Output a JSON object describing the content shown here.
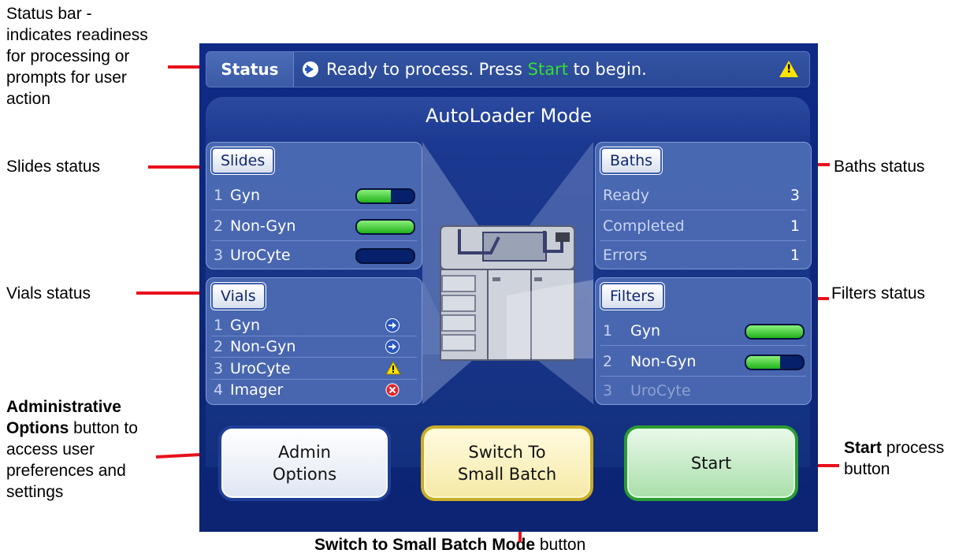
{
  "annotations": {
    "status_bar": [
      "Status bar -",
      "indicates readiness",
      "for processing or",
      "prompts for user",
      "action"
    ],
    "slides": "Slides status",
    "vials": "Vials status",
    "admin_bold": "Administrative",
    "admin_bold2": "Options",
    "admin_rest": [
      " button to",
      "access user",
      "preferences and",
      "settings"
    ],
    "baths": "Baths status",
    "filters": "Filters status",
    "start_bold": "Start",
    "start_rest": " process",
    "start_rest2": "button",
    "switch_bold": "Switch to Small Batch Mode",
    "switch_rest": " button"
  },
  "status": {
    "label": "Status",
    "message_prefix": "Ready to process.  Press ",
    "message_highlight": "Start",
    "message_suffix": " to begin.",
    "highlight_color": "#33dd33"
  },
  "mode_title": "AutoLoader Mode",
  "slides": {
    "button": "Slides",
    "rows": [
      {
        "num": "1",
        "label": "Gyn",
        "fill": 0.6
      },
      {
        "num": "2",
        "label": "Non-Gyn",
        "fill": 1.0
      },
      {
        "num": "3",
        "label": "UroCyte",
        "fill": 0.0
      }
    ]
  },
  "baths": {
    "button": "Baths",
    "rows": [
      {
        "label": "Ready",
        "value": "3"
      },
      {
        "label": "Completed",
        "value": "1"
      },
      {
        "label": "Errors",
        "value": "1"
      }
    ]
  },
  "vials": {
    "button": "Vials",
    "rows": [
      {
        "num": "1",
        "label": "Gyn",
        "icon": "arrow-icon"
      },
      {
        "num": "2",
        "label": "Non-Gyn",
        "icon": "arrow-icon"
      },
      {
        "num": "3",
        "label": "UroCyte",
        "icon": "warning-icon"
      },
      {
        "num": "4",
        "label": "Imager",
        "icon": "error-icon"
      }
    ]
  },
  "filters": {
    "button": "Filters",
    "rows": [
      {
        "num": "1",
        "label": "Gyn",
        "fill": 1.0
      },
      {
        "num": "2",
        "label": "Non-Gyn",
        "fill": 0.6
      },
      {
        "num": "3",
        "label": "UroCyte",
        "fill": 0.0,
        "disabled": true
      }
    ]
  },
  "buttons": {
    "admin": [
      "Admin",
      "Options"
    ],
    "switch": [
      "Switch To",
      "Small Batch"
    ],
    "start": "Start"
  },
  "colors": {
    "accent_line": "#e8111a",
    "screen_bg": "#0f2a86"
  }
}
